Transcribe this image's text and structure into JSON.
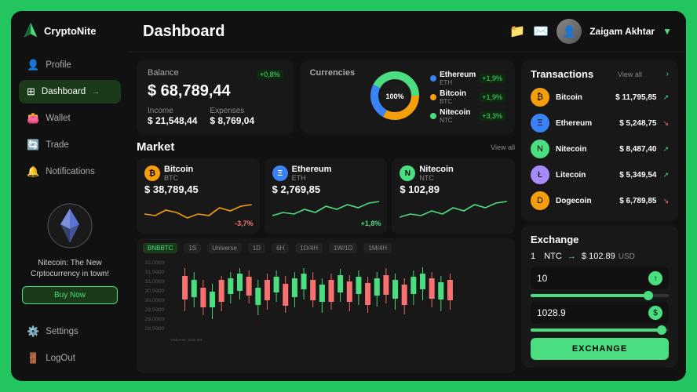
{
  "app": {
    "name": "CryptoNite"
  },
  "header": {
    "title": "Dashboard",
    "user_name": "Zaigam Akhtar"
  },
  "sidebar": {
    "nav_items": [
      {
        "id": "profile",
        "label": "Profile",
        "icon": "👤",
        "active": false
      },
      {
        "id": "dashboard",
        "label": "Dashboard",
        "icon": "⊞",
        "active": true
      },
      {
        "id": "wallet",
        "label": "Wallet",
        "icon": "👛",
        "active": false
      },
      {
        "id": "trade",
        "label": "Trade",
        "icon": "🔄",
        "active": false
      },
      {
        "id": "notifications",
        "label": "Notifications",
        "icon": "🔔",
        "active": false
      }
    ],
    "promo_text": "Nitecoin: The New Crptocurrency in town!",
    "buy_btn_label": "Buy Now",
    "settings_label": "Settings",
    "logout_label": "LogOut"
  },
  "balance": {
    "card_title": "Balance",
    "amount": "$ 68,789,44",
    "badge": "+0,8%",
    "income_label": "Income",
    "income_amount": "$ 21,548,44",
    "expenses_label": "Expenses",
    "expenses_amount": "$ 8,769,04"
  },
  "currencies": {
    "card_title": "Currencies",
    "donut_label": "100%",
    "items": [
      {
        "name": "Ethereum",
        "ticker": "ETH",
        "pct": "+1,9%",
        "color": "#3b82f6",
        "positive": true
      },
      {
        "name": "Bitcoin",
        "ticker": "BTC",
        "pct": "+1,9%",
        "color": "#f59e0b",
        "positive": true
      },
      {
        "name": "Nitecoin",
        "ticker": "NTC",
        "pct": "+3,3%",
        "color": "#4ade80",
        "positive": true
      }
    ]
  },
  "transactions": {
    "title": "Transactions",
    "view_all": "View all",
    "items": [
      {
        "name": "Bitcoin",
        "amount": "$ 11,795,85",
        "positive": true,
        "color": "#f59e0b",
        "symbol": "₿"
      },
      {
        "name": "Ethereum",
        "amount": "$ 5,248,75",
        "positive": false,
        "color": "#3b82f6",
        "symbol": "Ξ"
      },
      {
        "name": "Nitecoin",
        "amount": "$ 8,487,40",
        "positive": true,
        "color": "#4ade80",
        "symbol": "N"
      },
      {
        "name": "Litecoin",
        "amount": "$ 5,349,54",
        "positive": true,
        "color": "#a78bfa",
        "symbol": "Ł"
      },
      {
        "name": "Dogecoin",
        "amount": "$ 6,789,85",
        "positive": false,
        "color": "#f59e0b",
        "symbol": "D"
      }
    ]
  },
  "market": {
    "title": "Market",
    "view_all": "View all",
    "cards": [
      {
        "name": "Bitcoin",
        "ticker": "BTC",
        "price": "$ 38,789,45",
        "pct": "-3,7%",
        "positive": false,
        "color": "#f59e0b",
        "symbol": "₿"
      },
      {
        "name": "Ethereum",
        "ticker": "ETH",
        "price": "$ 2,769,85",
        "pct": "+1,8%",
        "positive": true,
        "color": "#3b82f6",
        "symbol": "Ξ"
      },
      {
        "name": "Nitecoin",
        "ticker": "NTC",
        "price": "$ 102,89",
        "pct": "",
        "positive": true,
        "color": "#4ade80",
        "symbol": "N"
      }
    ],
    "chart_pills": [
      "BNBBTC",
      "1S",
      "Universe",
      "1D",
      "6H",
      "1D/4H",
      "1W/1D",
      "1M/4H"
    ]
  },
  "exchange": {
    "title": "Exchange",
    "from_amount": "1",
    "from_currency": "NTC",
    "to_amount": "$ 102.89",
    "to_currency": "USD",
    "input1": "10",
    "input2": "1028.9",
    "slider1_pct": 85,
    "slider2_pct": 95,
    "btn_label": "EXCHANGE"
  }
}
